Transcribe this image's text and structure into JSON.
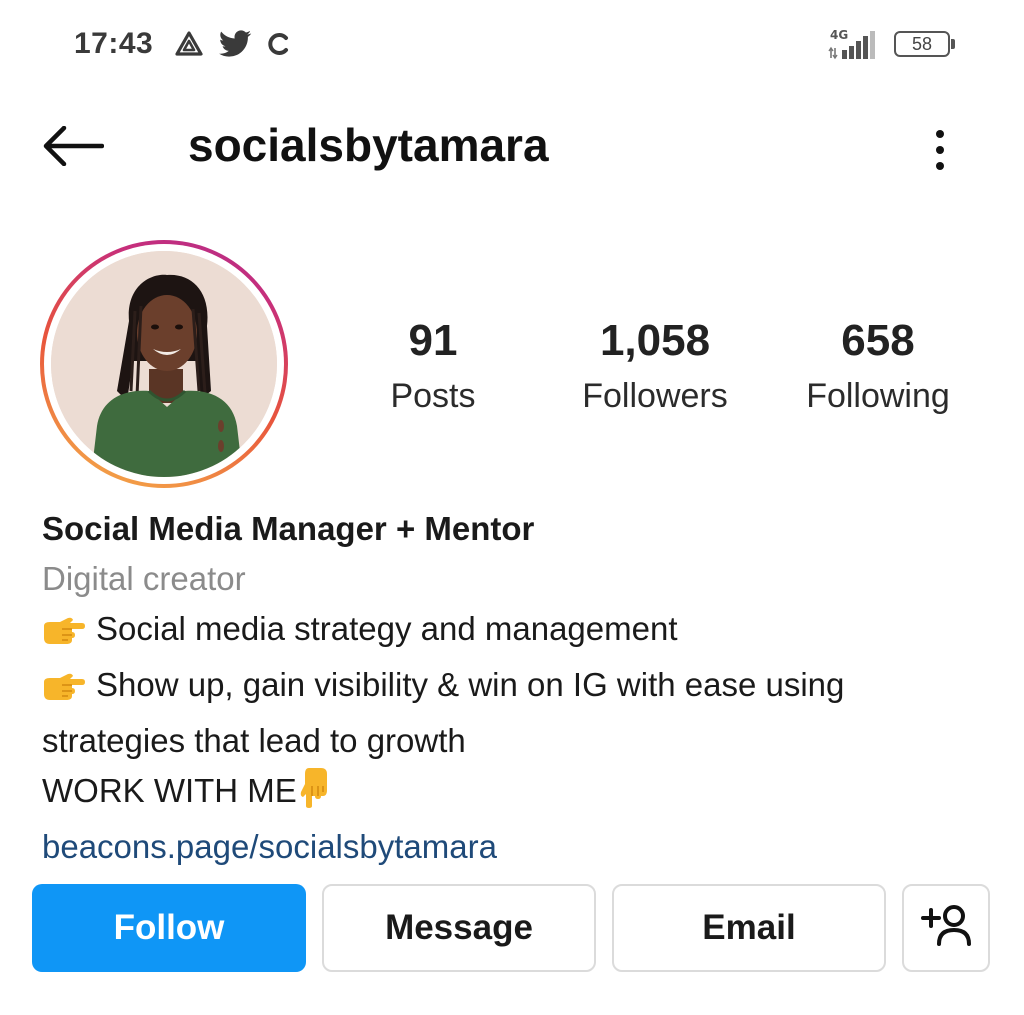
{
  "status_bar": {
    "time": "17:43",
    "network": "4G",
    "battery": "58",
    "icons": [
      "drive-icon",
      "twitter-icon",
      "sync-icon",
      "signal-icon",
      "battery-icon"
    ]
  },
  "header": {
    "username": "socialsbytamara",
    "back_icon": "back-arrow-icon",
    "more_icon": "more-vertical-icon"
  },
  "stats": {
    "posts": {
      "value": "91",
      "label": "Posts"
    },
    "followers": {
      "value": "1,058",
      "label": "Followers"
    },
    "following": {
      "value": "658",
      "label": "Following"
    }
  },
  "bio": {
    "name": "Social Media Manager + Mentor",
    "category": "Digital creator",
    "lines": [
      "Social media strategy and management",
      "Show up, gain visibility & win on IG with ease using strategies that lead to growth",
      "WORK WITH ME"
    ],
    "link": "beacons.page/socialsbytamara"
  },
  "actions": {
    "follow": "Follow",
    "message": "Message",
    "email": "Email",
    "add_icon": "add-person-icon"
  },
  "colors": {
    "primary_button": "#0f96f6",
    "link": "#1f4a79",
    "category": "#8b8b8b",
    "border": "#dbdbdb"
  }
}
